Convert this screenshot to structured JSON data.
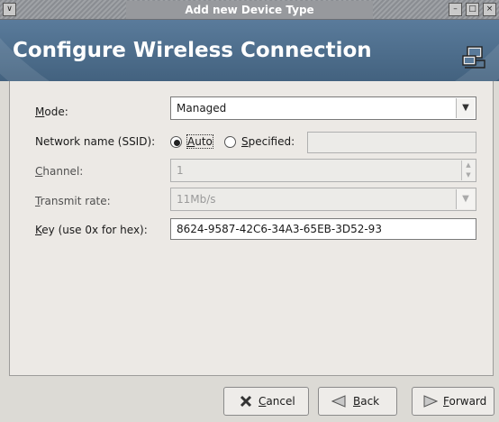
{
  "window": {
    "title": "Add new Device Type",
    "menu_glyph": "∨",
    "min_glyph": "–",
    "max_glyph": "□",
    "close_glyph": "×"
  },
  "header": {
    "title": "Configure Wireless Connection",
    "icon": "network-computer-icon"
  },
  "form": {
    "mode": {
      "label_ul": "M",
      "label_rest": "ode:",
      "value": "Managed"
    },
    "ssid": {
      "label": "Network name (SSID):",
      "auto_ul": "A",
      "auto_rest": "uto",
      "specified_ul": "S",
      "specified_rest": "pecified:",
      "selected": "auto",
      "specified_value": ""
    },
    "channel": {
      "label_ul": "C",
      "label_rest": "hannel:",
      "value": "1"
    },
    "rate": {
      "label_ul": "T",
      "label_rest": "ransmit rate:",
      "value": "11Mb/s"
    },
    "key": {
      "label_ul": "K",
      "label_rest": "ey (use 0x for hex):",
      "value": "8624-9587-42C6-34A3-65EB-3D52-93"
    }
  },
  "buttons": {
    "cancel": {
      "ul": "C",
      "rest": "ancel",
      "icon": "cancel-x-icon"
    },
    "back": {
      "ul": "B",
      "rest": "ack",
      "icon": "back-arrow-icon"
    },
    "forward": {
      "ul": "F",
      "rest": "orward",
      "icon": "forward-arrow-icon"
    }
  },
  "colors": {
    "banner": "#4f6f8f",
    "titlebar": "#9a9da1",
    "panel": "#ece9e5"
  }
}
